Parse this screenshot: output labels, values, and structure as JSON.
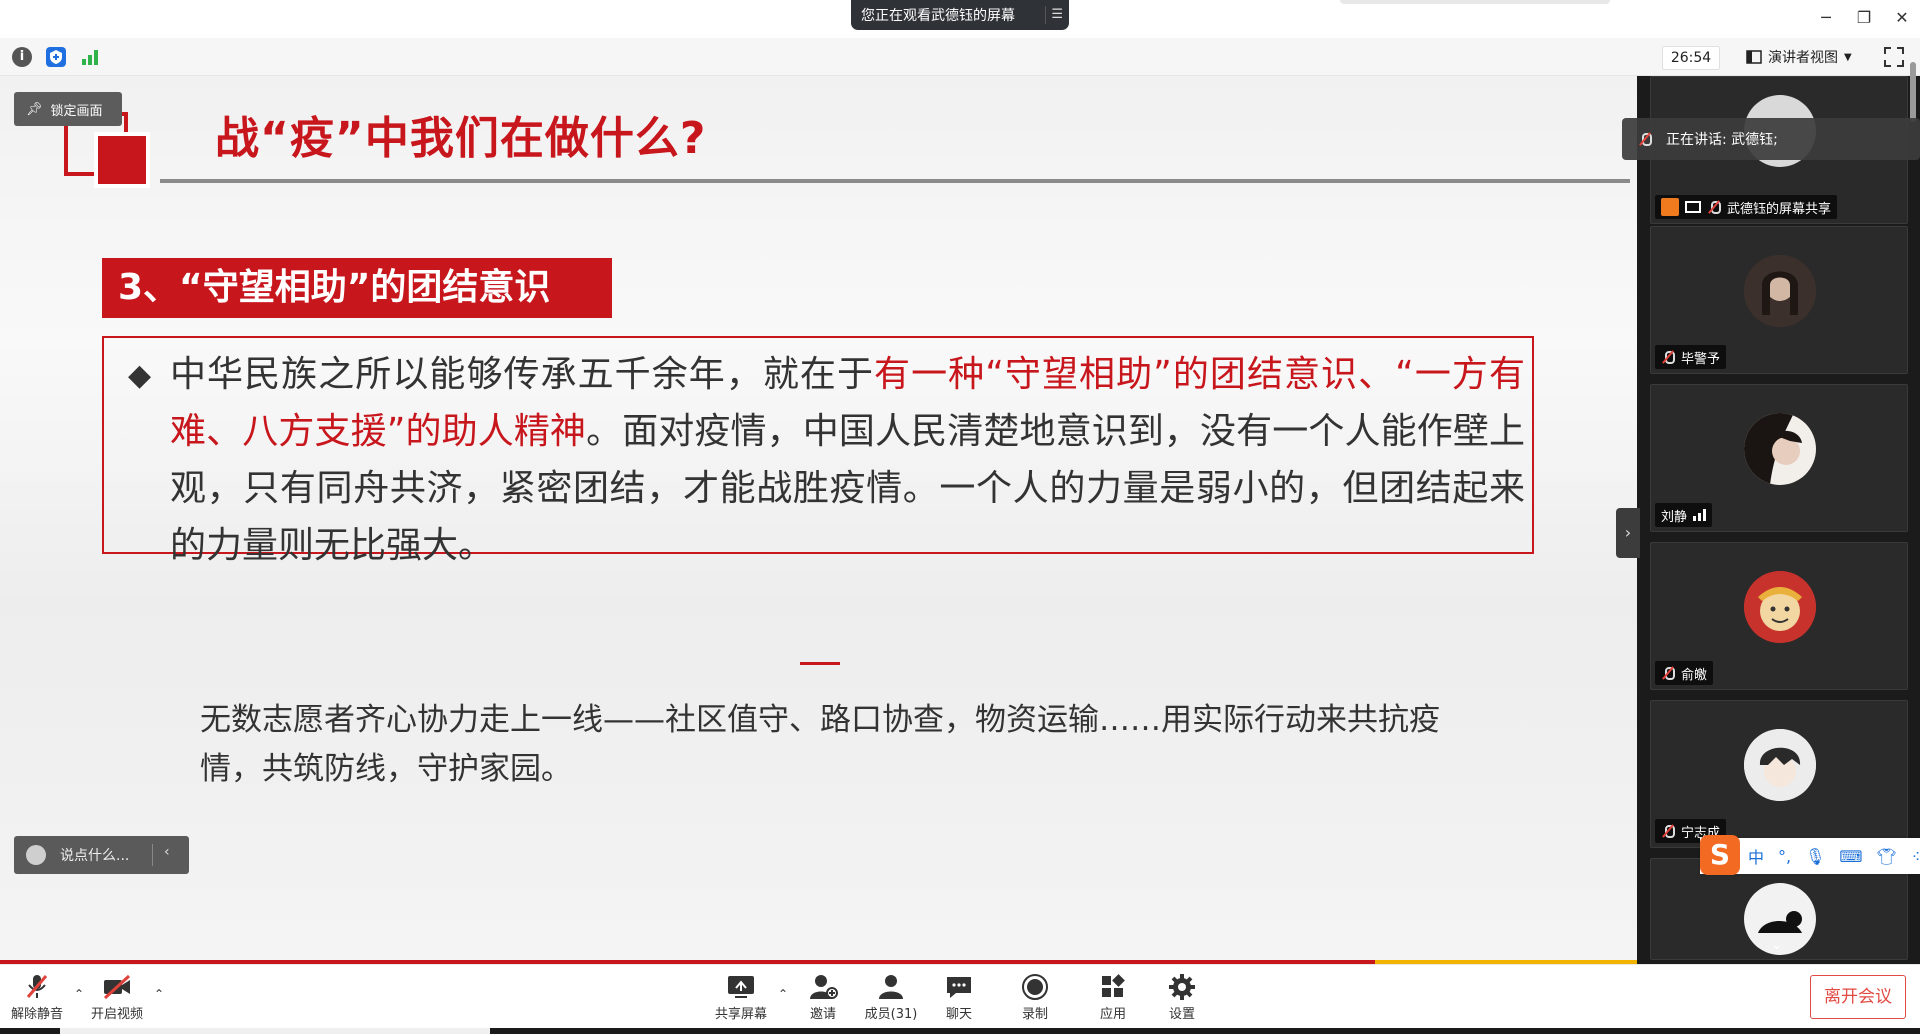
{
  "window": {
    "share_banner": "您正在观看武德钰的屏幕",
    "minimize_glyph": "─",
    "restore_glyph": "❐",
    "close_glyph": "✕"
  },
  "toolbar": {
    "timer": "26:54",
    "view_label": "演讲者视图"
  },
  "slide": {
    "title": "战“疫”中我们在做什么?",
    "pin_label": "锁定画面",
    "section_heading": "3、“守望相助”的团结意识",
    "bullet_segments": [
      {
        "text": "中华民族之所以能够传承五千余年，就在于",
        "highlight": false
      },
      {
        "text": "有一种“守望相助”的团结意识、“一方有难、八方支援”的助人精神",
        "highlight": true
      },
      {
        "text": "。面对疫情，中国人民清楚地意识到，没有一个人能作壁上观，只有同舟共济，紧密团结，才能战胜疫情。一个人的力量是弱小的，但团结起来的力量则无比强大。",
        "highlight": false
      }
    ],
    "bottom_text": "无数志愿者齐心协力走上一线——社区值守、路口协查，物资运输……用实际行动来共抗疫情，共筑防线，守护家园。",
    "chat_placeholder": "说点什么..."
  },
  "side_panel": {
    "speaking_label": "正在讲话: 武德钰;",
    "participants": [
      {
        "name": "武德钰的屏幕共享",
        "mic": "muted",
        "avatar_color": "#d9d9d9"
      },
      {
        "name": "毕警予",
        "mic": "muted",
        "avatar_color": "#4a3b33"
      },
      {
        "name": "刘静",
        "mic": "signal",
        "avatar_color": "#3a3230"
      },
      {
        "name": "俞皦",
        "mic": "muted",
        "avatar_color": "#c8322d"
      },
      {
        "name": "宁志成",
        "mic": "muted",
        "avatar_color": "#e8e8e8"
      },
      {
        "name": "",
        "mic": "none",
        "avatar_color": "#1e1e1e"
      }
    ],
    "ime": {
      "logo": "S",
      "lang": "中",
      "punct": "°,"
    }
  },
  "controls": {
    "unmute": "解除静音",
    "start_video": "开启视频",
    "share_screen": "共享屏幕",
    "invite": "邀请",
    "members": "成员(31)",
    "chat": "聊天",
    "record": "录制",
    "apps": "应用",
    "settings": "设置",
    "leave": "离开会议"
  },
  "colors": {
    "accent_red": "#c8161d",
    "leave_red": "#e24a44",
    "panel_bg": "#1b1b1b",
    "slide_gold": "#f2b200"
  }
}
